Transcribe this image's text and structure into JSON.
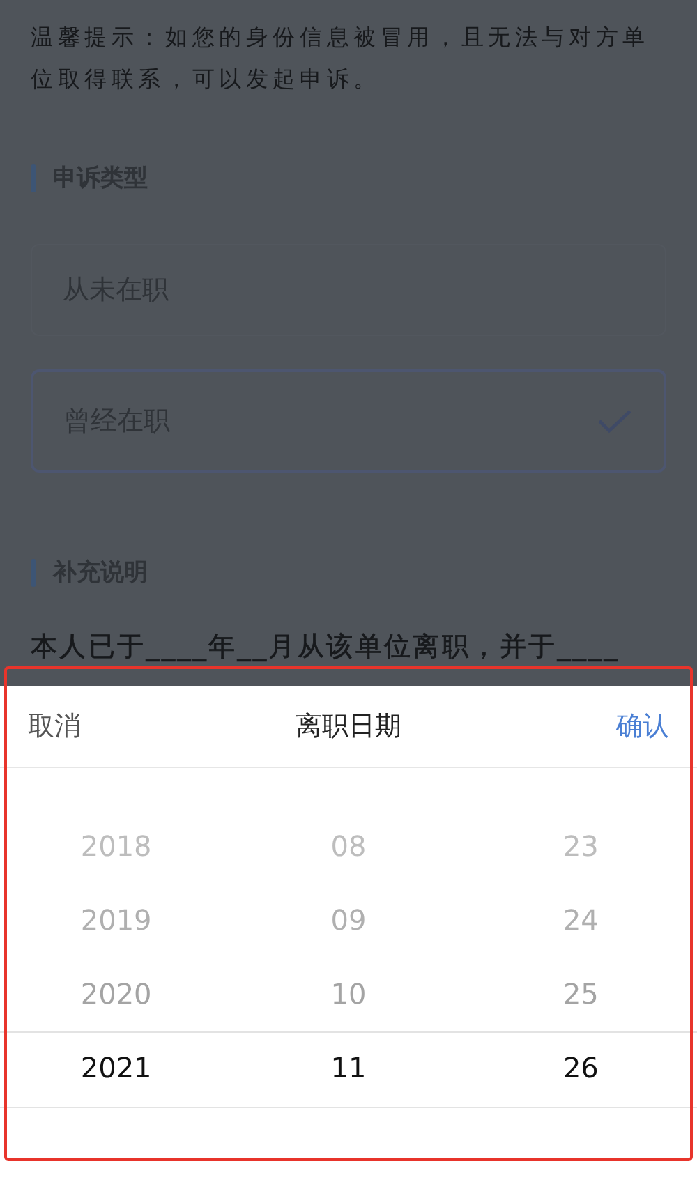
{
  "notice": "温馨提示：如您的身份信息被冒用，且无法与对方单位取得联系，可以发起申诉。",
  "sections": [
    {
      "title": "申诉类型",
      "options": [
        {
          "label": "从未在职",
          "selected": false
        },
        {
          "label": "曾经在职",
          "selected": true
        }
      ]
    },
    {
      "title": "补充说明",
      "text": "本人已于____年__月从该单位离职，并于____"
    }
  ],
  "picker": {
    "cancel": "取消",
    "title": "离职日期",
    "confirm": "确认",
    "columns": [
      {
        "items": [
          {
            "label": "2018",
            "selected": false
          },
          {
            "label": "2019",
            "selected": false
          },
          {
            "label": "2020",
            "selected": false
          },
          {
            "label": "2021",
            "selected": true
          }
        ]
      },
      {
        "items": [
          {
            "label": "08",
            "selected": false
          },
          {
            "label": "09",
            "selected": false
          },
          {
            "label": "10",
            "selected": false
          },
          {
            "label": "11",
            "selected": true
          }
        ]
      },
      {
        "items": [
          {
            "label": "23",
            "selected": false
          },
          {
            "label": "24",
            "selected": false
          },
          {
            "label": "25",
            "selected": false
          },
          {
            "label": "26",
            "selected": true
          }
        ]
      }
    ]
  }
}
